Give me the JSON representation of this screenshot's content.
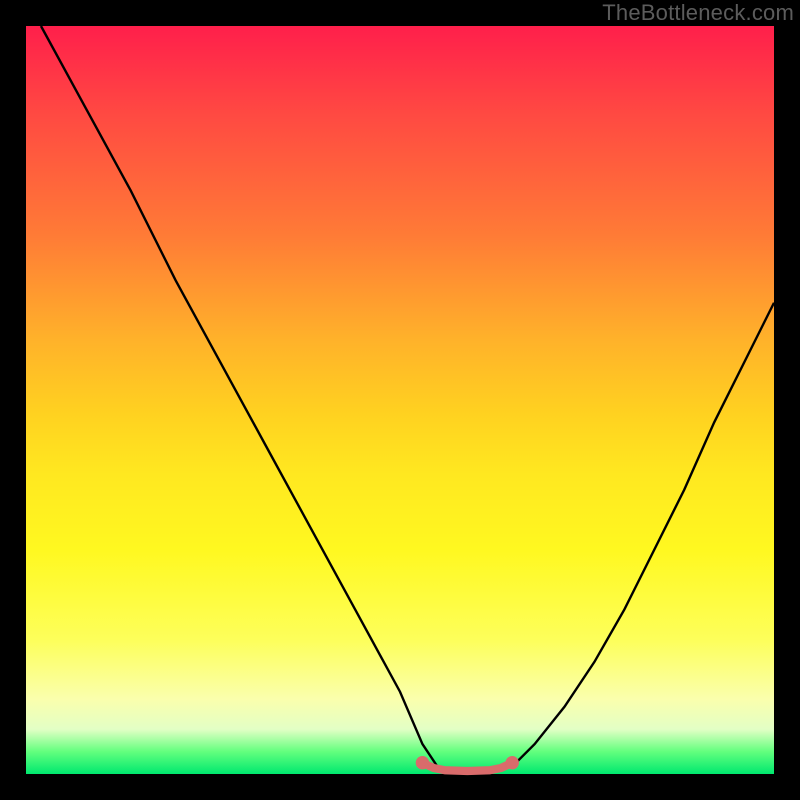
{
  "watermark": "TheBottleneck.com",
  "chart_data": {
    "type": "line",
    "title": "",
    "xlabel": "",
    "ylabel": "",
    "xlim": [
      0,
      100
    ],
    "ylim": [
      0,
      100
    ],
    "series": [
      {
        "name": "left-curve",
        "x": [
          2,
          8,
          14,
          20,
          26,
          32,
          38,
          44,
          50,
          53,
          55
        ],
        "y": [
          100,
          89,
          78,
          66,
          55,
          44,
          33,
          22,
          11,
          4,
          1
        ]
      },
      {
        "name": "right-curve",
        "x": [
          65,
          68,
          72,
          76,
          80,
          84,
          88,
          92,
          96,
          100
        ],
        "y": [
          1,
          4,
          9,
          15,
          22,
          30,
          38,
          47,
          55,
          63
        ]
      },
      {
        "name": "trough-marker",
        "x": [
          53,
          54.5,
          56,
          57.5,
          59,
          60.5,
          62,
          63.5,
          65
        ],
        "y": [
          1.5,
          0.8,
          0.5,
          0.45,
          0.4,
          0.45,
          0.5,
          0.8,
          1.5
        ]
      }
    ],
    "colors": {
      "curve": "#000000",
      "trough": "#d96b6b"
    }
  }
}
